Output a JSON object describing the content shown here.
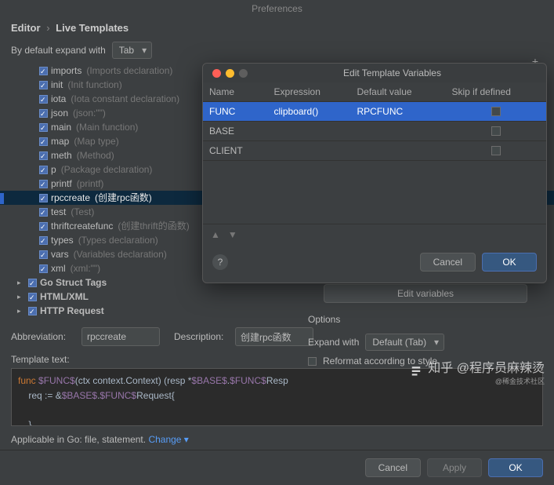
{
  "window": {
    "title": "Preferences"
  },
  "breadcrumb": {
    "a": "Editor",
    "b": "Live Templates"
  },
  "expand": {
    "label": "By default expand with",
    "value": "Tab"
  },
  "add_icon": "+",
  "tree": {
    "items": [
      {
        "key": "imports",
        "desc": "(Imports declaration)"
      },
      {
        "key": "init",
        "desc": "(Init function)"
      },
      {
        "key": "iota",
        "desc": "(Iota constant declaration)"
      },
      {
        "key": "json",
        "desc": "(json:\"\")"
      },
      {
        "key": "main",
        "desc": "(Main function)"
      },
      {
        "key": "map",
        "desc": "(Map type)"
      },
      {
        "key": "meth",
        "desc": "(Method)"
      },
      {
        "key": "p",
        "desc": "(Package declaration)"
      },
      {
        "key": "printf",
        "desc": "(printf)"
      },
      {
        "key": "rpccreate",
        "desc": "(创建rpc函数)",
        "selected": true
      },
      {
        "key": "test",
        "desc": "(Test)"
      },
      {
        "key": "thriftcreatefunc",
        "desc": "(创建thrift的函数)"
      },
      {
        "key": "types",
        "desc": "(Types declaration)"
      },
      {
        "key": "vars",
        "desc": "(Variables declaration)"
      },
      {
        "key": "xml",
        "desc": "(xml:\"\")"
      }
    ],
    "groups": [
      {
        "label": "Go Struct Tags"
      },
      {
        "label": "HTML/XML"
      },
      {
        "label": "HTTP Request"
      }
    ]
  },
  "abbr": {
    "label": "Abbreviation:",
    "value": "rpccreate"
  },
  "description": {
    "label": "Description:",
    "value": "创建rpc函数"
  },
  "template_text": {
    "label": "Template text:",
    "l1a": "func ",
    "l1b": "$FUNC$",
    "l1c": "(ctx context.Context) (resp *",
    "l1d": "$BASE$",
    "l1e": ".",
    "l1f": "$FUNC$",
    "l1g": "Resp",
    "l2a": "    req := &",
    "l2b": "$BASE$",
    "l2c": ".",
    "l2d": "$FUNC$",
    "l2e": "Request{",
    "l4": "    }"
  },
  "applicable": {
    "text": "Applicable in Go: file, statement.",
    "change": "Change ▾"
  },
  "buttons": {
    "cancel": "Cancel",
    "apply": "Apply",
    "ok": "OK"
  },
  "right": {
    "edit_variables": "Edit variables",
    "options": "Options",
    "expand_with_label": "Expand with",
    "expand_with_value": "Default (Tab)",
    "reformat": "Reformat according to style"
  },
  "dialog": {
    "title": "Edit Template Variables",
    "cols": {
      "name": "Name",
      "expr": "Expression",
      "defv": "Default value",
      "skip": "Skip if defined"
    },
    "rows": [
      {
        "name": "FUNC",
        "expr": "clipboard()",
        "defv": "RPCFUNC",
        "selected": true
      },
      {
        "name": "BASE",
        "expr": "",
        "defv": ""
      },
      {
        "name": "CLIENT",
        "expr": "",
        "defv": ""
      }
    ],
    "help": "?",
    "cancel": "Cancel",
    "ok": "OK"
  },
  "watermark": {
    "text": "知乎 @程序员麻辣烫",
    "sub": "@稀金技术社区"
  }
}
